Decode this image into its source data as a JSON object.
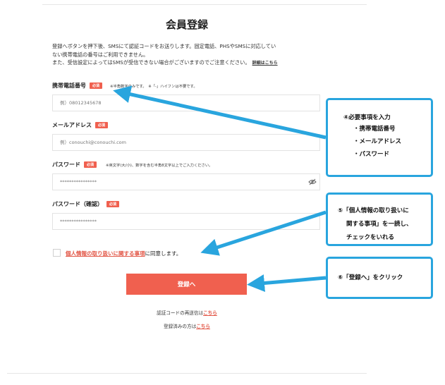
{
  "form": {
    "title": "会員登録",
    "intro_line1": "登録へボタンを押下後、SMSにて認証コードをお送りします。固定電話、PHSやSMSに対応してい",
    "intro_line2": "ない携帯電話の番号はご利用できません。",
    "intro_line3": "また、受信設定によってはSMSが受信できない場合がございますのでご注意ください。",
    "intro_detail_link": "詳細はこちら",
    "required_badge": "必須",
    "phone": {
      "label": "携帯電話番号",
      "note": "※半角数字のみです。　※「-」ハイフンは不要です。",
      "placeholder": "例）08012345678"
    },
    "email": {
      "label": "メールアドレス",
      "placeholder": "例）conouchi@conouchi.com"
    },
    "password": {
      "label": "パスワード",
      "note": "※英文字(大/小)、数字を含む半角8文字以上でご入力ください。",
      "placeholder": "****************"
    },
    "password_confirm": {
      "label": "パスワード（確認）",
      "placeholder": "****************"
    },
    "agree": {
      "link_text": "個人情報の取り扱いに関する事項",
      "suffix_text": "に同意します。"
    },
    "submit_label": "登録へ",
    "resend_text": "認証コードの再送信は",
    "resend_link": "こちら",
    "registered_text": "登録済みの方は",
    "registered_link": "こちら"
  },
  "callouts": [
    {
      "head": "④必要事項を入力",
      "items": [
        "・携帯電話番号",
        "・メールアドレス",
        "・パスワード"
      ]
    },
    {
      "line1": "⑤「個人情報の取り扱いに",
      "line2": "関する事項」を一読し、",
      "line3": "チェックをいれる"
    },
    {
      "head": "⑥「登録へ」をクリック"
    }
  ],
  "colors": {
    "accent": "#f0604f",
    "link": "#e25646",
    "callout_border": "#29a5de"
  }
}
